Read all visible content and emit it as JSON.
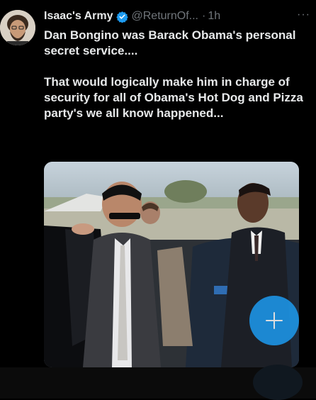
{
  "tweet": {
    "author_name": "Isaac's Army",
    "handle": "@ReturnOf...",
    "separator": "·",
    "time": "1h",
    "more_label": "···",
    "paragraphs": [
      "Dan Bongino was Barack Obama's personal secret service....",
      "That would logically make him in charge of security for all of Obama's Hot Dog and Pizza party's we all know happened..."
    ],
    "image_description": "photo"
  },
  "compose_fab": {
    "icon": "plus-icon"
  },
  "colors": {
    "background": "#000000",
    "text": "#e7e9ea",
    "muted": "#71767b",
    "accent": "#1d9bf0"
  }
}
